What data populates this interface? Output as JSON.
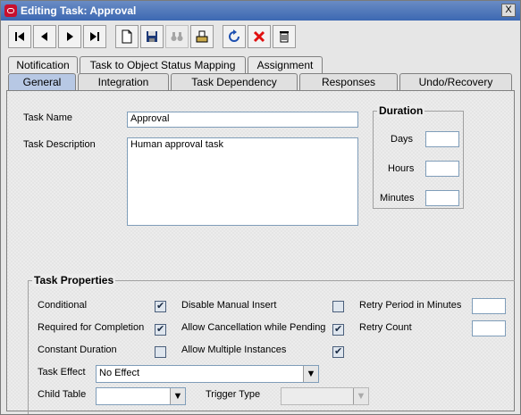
{
  "window": {
    "title": "Editing Task: Approval",
    "close_label": "X"
  },
  "toolbar": {
    "buttons": [
      "first-record-icon",
      "previous-record-icon",
      "next-record-icon",
      "last-record-icon",
      "new-icon",
      "save-icon",
      "find-icon",
      "import-icon",
      "refresh-icon",
      "cancel-icon",
      "delete-icon"
    ]
  },
  "tabs": {
    "back_row": [
      "Notification",
      "Task to Object Status Mapping",
      "Assignment"
    ],
    "front_row": [
      "General",
      "Integration",
      "Task Dependency",
      "Responses",
      "Undo/Recovery"
    ],
    "active": "General"
  },
  "general": {
    "task_name_label": "Task Name",
    "task_name_value": "Approval",
    "task_description_label": "Task Description",
    "task_description_value": "Human approval task",
    "duration": {
      "title": "Duration",
      "days_label": "Days",
      "days_value": "",
      "hours_label": "Hours",
      "hours_value": "",
      "minutes_label": "Minutes",
      "minutes_value": ""
    },
    "properties": {
      "title": "Task Properties",
      "conditional_label": "Conditional",
      "conditional_checked": true,
      "required_label": "Required for Completion",
      "required_checked": true,
      "constant_duration_label": "Constant Duration",
      "constant_duration_checked": false,
      "disable_manual_insert_label": "Disable Manual Insert",
      "disable_manual_insert_checked": false,
      "allow_cancellation_label": "Allow Cancellation while Pending",
      "allow_cancellation_checked": true,
      "allow_multiple_label": "Allow Multiple Instances",
      "allow_multiple_checked": true,
      "retry_period_label": "Retry Period in Minutes",
      "retry_period_value": "",
      "retry_count_label": "Retry Count",
      "retry_count_value": "",
      "task_effect_label": "Task Effect",
      "task_effect_value": "No Effect",
      "child_table_label": "Child Table",
      "child_table_value": "",
      "trigger_type_label": "Trigger Type",
      "trigger_type_value": ""
    }
  }
}
